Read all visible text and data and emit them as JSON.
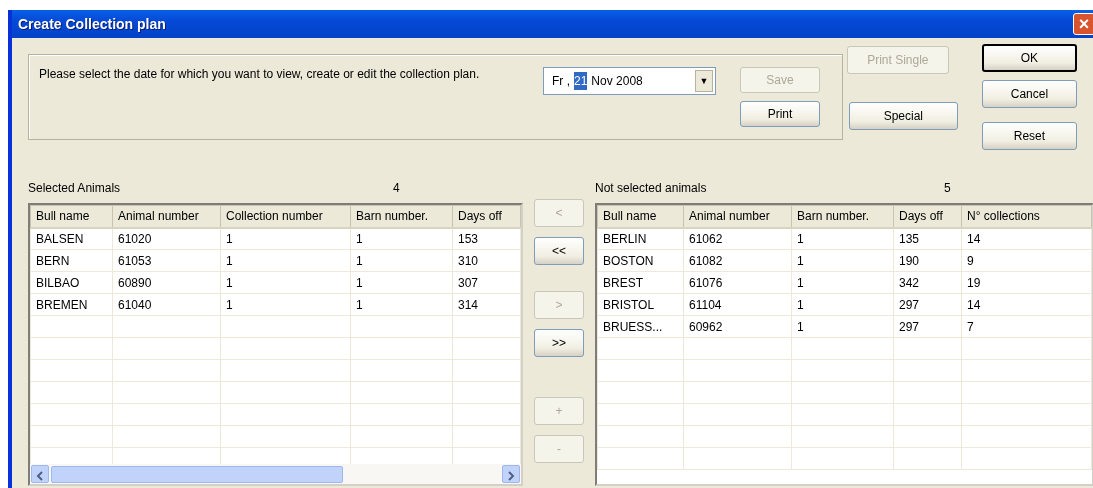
{
  "window": {
    "title": "Create Collection plan",
    "close_label": "×"
  },
  "prompt": "Please select the date for which you want to view, create or edit the collection plan.",
  "date_picker": {
    "weekday": "Fr ,",
    "day": "21",
    "month_year": "Nov 2008",
    "day_selected": true,
    "dropdown_label": "▼"
  },
  "group_buttons": [
    {
      "label": "Save",
      "disabled": true
    },
    {
      "label": "Print",
      "disabled": false
    }
  ],
  "side_buttons": [
    {
      "label": "Print Single",
      "disabled": true
    },
    {
      "label": "Special",
      "disabled": false
    }
  ],
  "dialog_buttons": [
    {
      "label": "OK",
      "default": true
    },
    {
      "label": "Cancel",
      "default": false
    },
    {
      "label": "Reset",
      "default": false
    }
  ],
  "selected_animals": {
    "title": "Selected Animals",
    "count": "4",
    "columns": [
      "Bull name",
      "Animal number",
      "Collection number",
      "Barn number.",
      "Days off"
    ],
    "rows": [
      [
        "BALSEN",
        "61020",
        "1",
        "1",
        "153"
      ],
      [
        "BERN",
        "61053",
        "1",
        "1",
        "310"
      ],
      [
        "BILBAO",
        "60890",
        "1",
        "1",
        "307"
      ],
      [
        "BREMEN",
        "61040",
        "1",
        "1",
        "314"
      ]
    ]
  },
  "transfer_buttons": [
    {
      "label": "<",
      "disabled": true
    },
    {
      "label": "<<",
      "disabled": false
    },
    {
      "label": ">",
      "disabled": true
    },
    {
      "label": ">>",
      "disabled": false
    },
    {
      "label": "+",
      "disabled": true
    },
    {
      "label": "-",
      "disabled": true
    }
  ],
  "not_selected_animals": {
    "title": "Not selected animals",
    "count": "5",
    "columns": [
      "Bull name",
      "Animal number",
      "Barn number.",
      "Days off",
      "N° collections"
    ],
    "rows": [
      [
        "BERLIN",
        "61062",
        "1",
        "135",
        "14"
      ],
      [
        "BOSTON",
        "61082",
        "1",
        "190",
        "9"
      ],
      [
        "BREST",
        "61076",
        "1",
        "342",
        "19"
      ],
      [
        "BRISTOL",
        "61104",
        "1",
        "297",
        "14"
      ],
      [
        "BRUESS...",
        "60962",
        "1",
        "297",
        "7"
      ]
    ]
  }
}
